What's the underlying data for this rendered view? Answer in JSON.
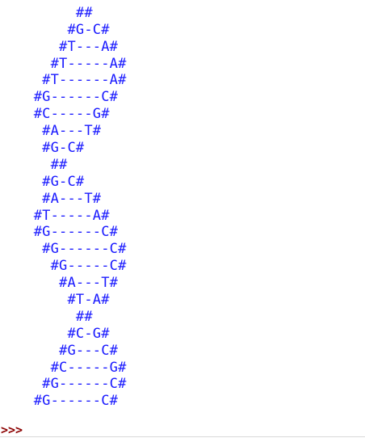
{
  "console": {
    "output_lines": [
      "        #G-C#",
      "         ##",
      "        #G-C#",
      "       #T---A#",
      "      #T-----A#",
      "     #T------A#",
      "    #G------C#",
      "    #C-----G#",
      "     #A---T#",
      "     #G-C#",
      "      ##",
      "     #G-C#",
      "     #A---T#",
      "    #T-----A#",
      "    #G------C#",
      "     #G------C#",
      "      #G-----C#",
      "       #A---T#",
      "        #T-A#",
      "         ##",
      "        #C-G#",
      "       #G---C#",
      "      #C-----G#",
      "     #G------C#",
      "    #G------C#"
    ],
    "prompt": ">>>",
    "input_value": ""
  },
  "colors": {
    "output_text": "#1a1aff",
    "prompt_text": "#8b0000",
    "background": "#ffffff"
  }
}
